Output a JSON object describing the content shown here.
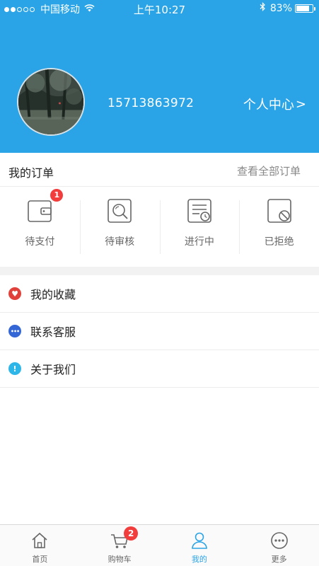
{
  "status_bar": {
    "carrier": "中国移动",
    "time": "上午10:27",
    "battery": "83%",
    "battery_level": 0.83,
    "signal_bars_filled": 2,
    "signal_bars_total": 5
  },
  "header": {
    "bg_color": "#2aa4e6",
    "phone": "15713863972",
    "profile_link": "个人中心",
    "profile_chevron": ">"
  },
  "orders": {
    "title": "我的订单",
    "view_all": "查看全部订单",
    "items": [
      {
        "label": "待支付",
        "icon": "wallet-icon",
        "badge": "1"
      },
      {
        "label": "待审核",
        "icon": "search-review-icon"
      },
      {
        "label": "进行中",
        "icon": "list-clock-icon"
      },
      {
        "label": "已拒绝",
        "icon": "rejected-icon"
      }
    ]
  },
  "menu": {
    "items": [
      {
        "label": "我的收藏",
        "icon": "heart-icon",
        "color": "#e0413a",
        "glyph": "♥"
      },
      {
        "label": "联系客服",
        "icon": "chat-icon",
        "color": "#3466d6",
        "glyph": "•••"
      },
      {
        "label": "关于我们",
        "icon": "info-icon",
        "color": "#2fb6e8",
        "glyph": "!"
      }
    ]
  },
  "tabbar": {
    "active_color": "#2aa4e6",
    "badge_color": "#f23d3d",
    "tabs": [
      {
        "label": "首页",
        "icon": "home-icon"
      },
      {
        "label": "购物车",
        "icon": "cart-icon",
        "badge": "2"
      },
      {
        "label": "我的",
        "icon": "user-icon",
        "active": true
      },
      {
        "label": "更多",
        "icon": "more-icon"
      }
    ]
  }
}
